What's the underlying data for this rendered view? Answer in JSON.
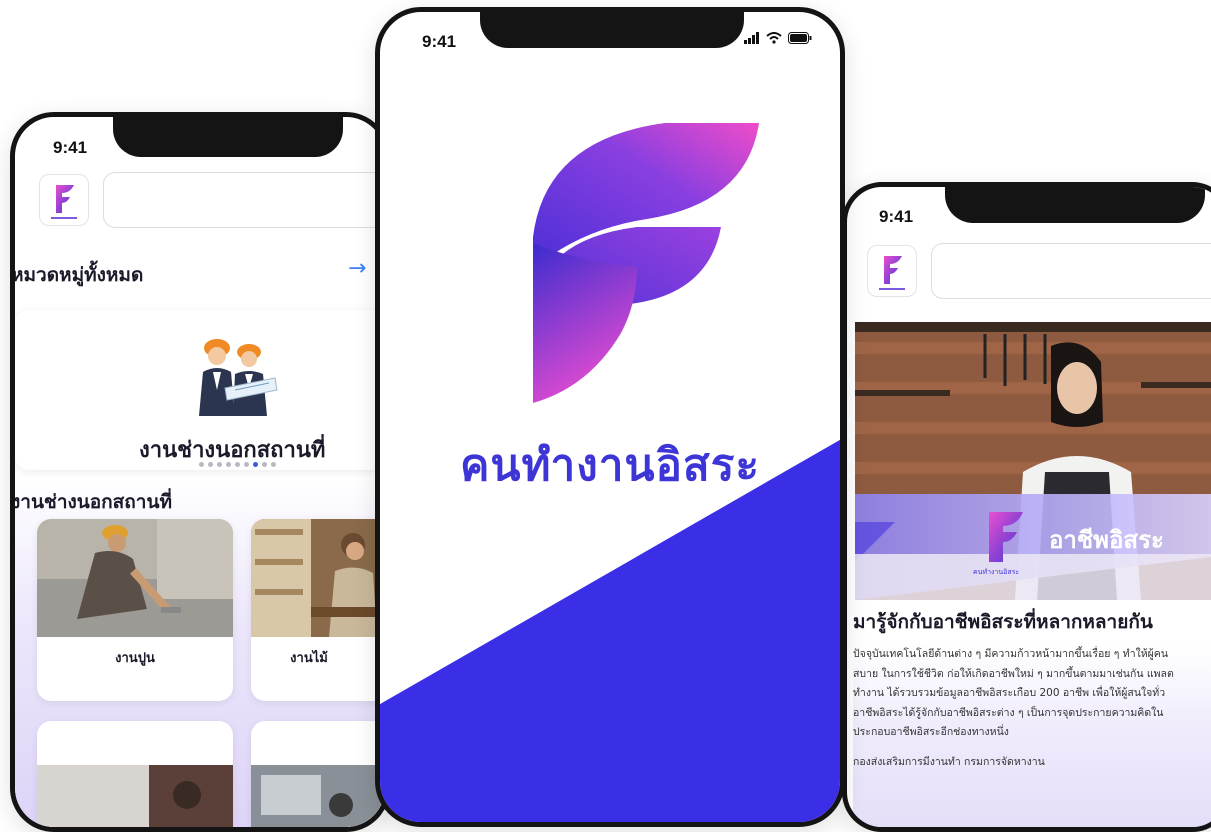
{
  "left_phone": {
    "status_time": "9:41",
    "categories_title": "หมวดหมู่ทั้งหมด",
    "featured_category_label": "งานช่างนอกสถานที่",
    "carousel_dot_count": 9,
    "carousel_active_dot": 6,
    "section_title": "งานช่างนอกสถานที่",
    "jobs": [
      {
        "label": "งานปูน"
      },
      {
        "label": "งานไม้"
      }
    ]
  },
  "center_phone": {
    "status_time": "9:41",
    "app_name": "คนทำงานอิสระ"
  },
  "right_phone": {
    "status_time": "9:41",
    "banner_title": "อาชีพอิสระ",
    "banner_logo_caption": "คนทำงานอิสระ",
    "article_title": "มารู้จักกับอาชีพอิสระที่หลากหลายกัน",
    "article_lines": [
      "ปัจจุบันเทคโนโลยีด้านต่าง ๆ มีความก้าวหน้ามากขึ้นเรื่อย ๆ ทำให้ผู้คน",
      "สบาย ในการใช้ชีวิต ก่อให้เกิดอาชีพใหม่ ๆ มากขึ้นตามมาเช่นกัน แพลต",
      "ทำงาน ได้รวบรวมข้อมูลอาชีพอิสระเกือบ 200 อาชีพ เพื่อให้ผู้สนใจทั่ว",
      "อาชีพอิสระได้รู้จักกับอาชีพอิสระต่าง ๆ เป็นการจุดประกายความคิดใน",
      "ประกอบอาชีพอิสระอีกช่องทางหนึ่ง"
    ],
    "article_source": "กองส่งเสริมการมีงานทำ กรมการจัดหางาน"
  },
  "colors": {
    "brand_blue": "#3d35d6",
    "brand_pink": "#e94fd0",
    "diagonal_band": "#3a2ee6",
    "link_arrow": "#3b82f6"
  },
  "icons": {
    "app_logo": "F-gradient-logo",
    "see_all": "arrow-right-icon",
    "status": [
      "signal-icon",
      "wifi-icon",
      "battery-icon"
    ]
  }
}
